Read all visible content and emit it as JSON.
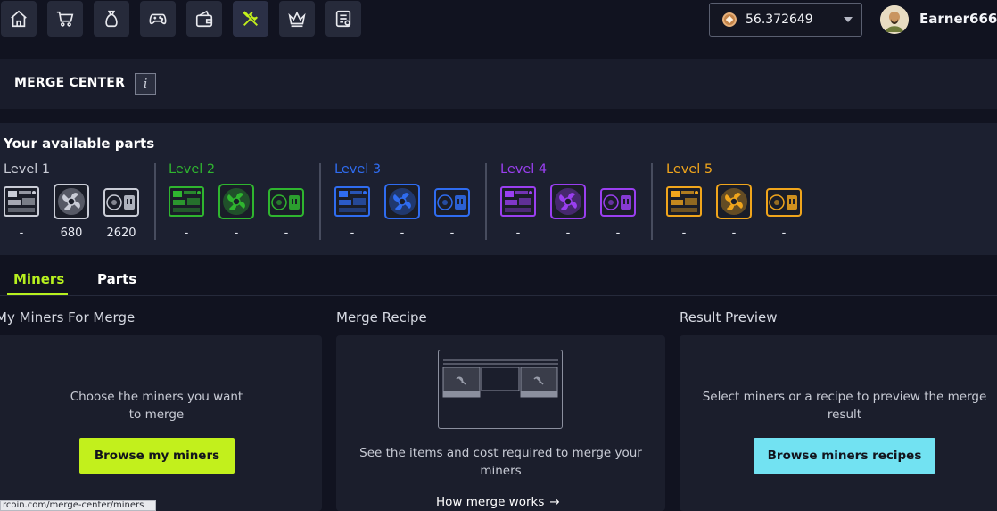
{
  "colors": {
    "accent_green": "#c2f01c",
    "accent_cyan": "#72e2f2",
    "level1": "#c9ccd6",
    "level2": "#2fb52f",
    "level3": "#2f6cf0",
    "level4": "#9a3ff0",
    "level5": "#f0a51c"
  },
  "nav": [
    {
      "icon": "home-icon"
    },
    {
      "icon": "cart-icon"
    },
    {
      "icon": "money-bag-icon"
    },
    {
      "icon": "gamepad-icon"
    },
    {
      "icon": "wallet-icon"
    },
    {
      "icon": "tools-icon",
      "active": true
    },
    {
      "icon": "crown-icon"
    },
    {
      "icon": "tasks-icon"
    }
  ],
  "wallet": {
    "balance": "56.372649",
    "coin_icon": "coin-icon"
  },
  "user": {
    "name": "Earner666"
  },
  "header": {
    "title": "MERGE CENTER",
    "info": "i"
  },
  "parts": {
    "title": "Your available parts",
    "levels": [
      {
        "label": "Level 1",
        "counts": [
          "-",
          "680",
          "2620"
        ]
      },
      {
        "label": "Level 2",
        "counts": [
          "-",
          "-",
          "-"
        ]
      },
      {
        "label": "Level 3",
        "counts": [
          "-",
          "-",
          "-"
        ]
      },
      {
        "label": "Level 4",
        "counts": [
          "-",
          "-",
          "-"
        ]
      },
      {
        "label": "Level 5",
        "counts": [
          "-",
          "-",
          "-"
        ]
      }
    ],
    "part_icons": [
      "board-icon",
      "fan-icon",
      "power-supply-icon"
    ]
  },
  "tabs": {
    "miners": "Miners",
    "parts": "Parts"
  },
  "columns": {
    "my_miners": {
      "title": "My Miners For Merge",
      "text_line1": "Choose the miners you want",
      "text_line2": "to merge",
      "button": "Browse my miners"
    },
    "recipe": {
      "title": "Merge Recipe",
      "text_line1": "See the items and cost required to merge your",
      "text_line2": "miners",
      "link": "How merge works",
      "link_arrow": "→"
    },
    "result": {
      "title": "Result Preview",
      "text_line1": "Select miners or a recipe to preview the merge",
      "text_line2": "result",
      "button": "Browse miners recipes"
    }
  },
  "status_url": "rcoin.com/merge-center/miners"
}
